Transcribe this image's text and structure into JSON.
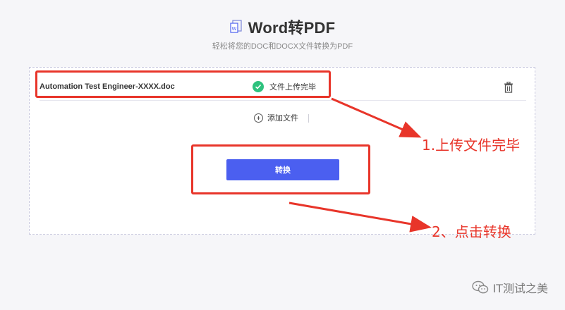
{
  "header": {
    "title": "Word转PDF",
    "subtitle": "轻松将您的DOC和DOCX文件转换为PDF",
    "title_icon": "word-file-icon"
  },
  "file": {
    "name": "Automation Test Engineer-XXXX.doc",
    "status": "文件上传完毕",
    "status_icon": "check-circle-icon",
    "delete_icon": "trash-icon"
  },
  "actions": {
    "add_file_label": "添加文件",
    "convert_label": "转换"
  },
  "annotations": {
    "step1": "1.上传文件完毕",
    "step2": "2、点击转换"
  },
  "watermark": {
    "text": "IT测试之美"
  },
  "colors": {
    "accent": "#4b5ff0",
    "success": "#2ec27e",
    "annotation": "#e8352a"
  }
}
